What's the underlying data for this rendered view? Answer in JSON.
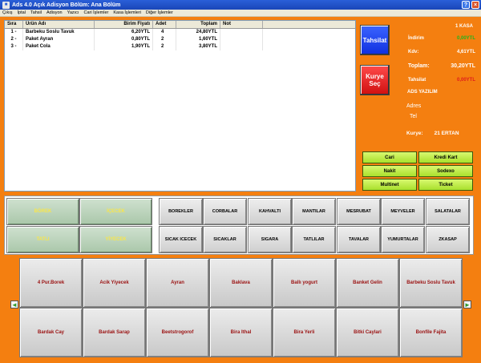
{
  "window": {
    "title": "Ads 4.0 Açık Adisyon Bölüm: Ana Bölüm",
    "btn_help": "?",
    "btn_min": "_",
    "btn_max": "□",
    "btn_close": "×"
  },
  "menu": [
    "Çıkış",
    "İptal",
    "Tahsil",
    "Adisyon",
    "Yazıcı",
    "Cari İşlemler",
    "Kasa İşlemleri",
    "Diğer İşlemler"
  ],
  "grid": {
    "headers": {
      "sira": "Sıra",
      "urun": "Ürün Adı",
      "birim": "Birim Fiyatı",
      "adet": "Adet",
      "toplam": "Toplam",
      "not": "Not"
    },
    "rows": [
      {
        "sira": "1 -",
        "urun": "Barbeku Soslu Tavuk",
        "birim": "6,20YTL",
        "adet": "4",
        "toplam": "24,80YTL",
        "not": ""
      },
      {
        "sira": "2 -",
        "urun": "Paket Ayran",
        "birim": "0,80YTL",
        "adet": "2",
        "toplam": "1,60YTL",
        "not": ""
      },
      {
        "sira": "3 -",
        "urun": "Paket Cola",
        "birim": "1,90YTL",
        "adet": "2",
        "toplam": "3,80YTL",
        "not": ""
      }
    ]
  },
  "summary": {
    "kasa": "1 KASA",
    "tahsilat_btn": "Tahsilat",
    "kurye_btn": "Kurye Seç",
    "indirim_label": "İndirim",
    "indirim_val": "0,00YTL",
    "kdv_label": "Kdv:",
    "kdv_val": "4,61YTL",
    "toplam_label": "Toplam:",
    "toplam_val": "30,20YTL",
    "tahsilat_label": "Tahsilat",
    "tahsilat_val": "0,00YTL",
    "company": "ADS YAZILIM",
    "adres_label": "Adres",
    "tel_label": "Tel",
    "kurye_label": "Kurye:",
    "kurye_val": "21 ERTAN"
  },
  "payments": [
    "Cari",
    "Kredi Kart",
    "Nakit",
    "Sodexo",
    "Multinet",
    "Ticket"
  ],
  "main_categories": [
    "BÖREK",
    "İÇECEK",
    "TATLI",
    "YİYECEK"
  ],
  "sub_categories": [
    "BOREKLER",
    "CORBALAR",
    "KAHVALTI",
    "MANTILAR",
    "MESRUBAT",
    "MEYVELER",
    "SALATALAR",
    "SICAK ICECEK",
    "SICAKLAR",
    "SIGARA",
    "TATLILAR",
    "TAVALAR",
    "YUMURTALAR",
    "ZKASAP"
  ],
  "products": [
    "4 Pur.Borek",
    "Acik Yiyecek",
    "Ayran",
    "Baklava",
    "Ballı yogurt",
    "Banket Gelin",
    "Barbeku Soslu Tavuk",
    "Bardak Cay",
    "Bardak Sarap",
    "Beetstrogorof",
    "Bira Ithal",
    "Bira Yerli",
    "Bitki Caylari",
    "Bonfile  Fajita"
  ],
  "nav": {
    "left": "◄",
    "right": "►"
  },
  "colors": {
    "background": "#f47f10",
    "titlebar": "#2a5fd8",
    "product_text": "#9a1010",
    "category_text": "#f9e64a",
    "payment_btn": "#a9e02c"
  }
}
